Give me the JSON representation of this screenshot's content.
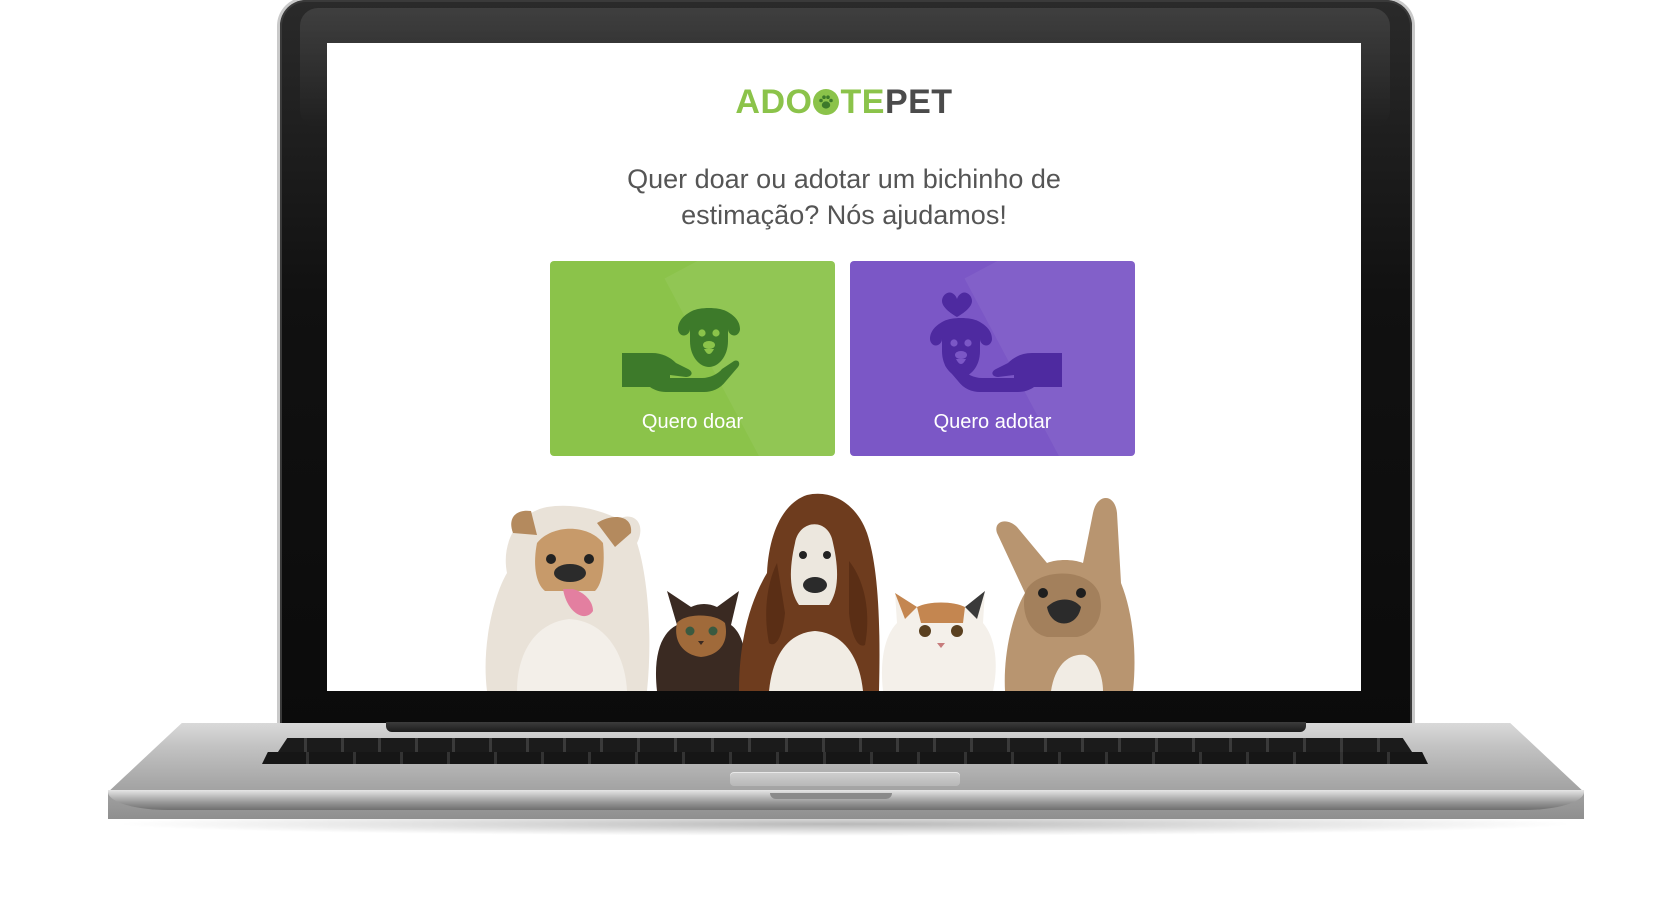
{
  "app": {
    "logo_left": "ADO",
    "logo_mid": "TE",
    "logo_right": "PET"
  },
  "hero": {
    "headline_line1": "Quer doar ou adotar um bichinho de",
    "headline_line2": "estimação? Nós ajudamos!"
  },
  "actions": {
    "donate_label": "Quero doar",
    "adopt_label": "Quero adotar"
  },
  "colors": {
    "brand_green": "#8bc34a",
    "brand_purple": "#7b57c6",
    "icon_green_dark": "#3d7a2a",
    "icon_purple_dark": "#4e2aa0",
    "text_gray": "#555555"
  },
  "icons": {
    "donate": "hand-giving-dog-icon",
    "adopt": "hand-receiving-dog-heart-icon",
    "logo": "paw-icon"
  },
  "illustration": {
    "pets": [
      "bulldog",
      "kitten",
      "basset-hound",
      "persian-cat",
      "french-bulldog"
    ]
  }
}
